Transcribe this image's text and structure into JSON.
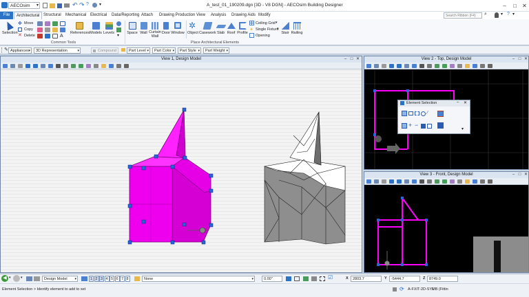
{
  "app": {
    "doc_combo": "AECOsim",
    "window_title": "A_test_01_190209.dgn [3D - V8 DGN] - AECOsim Building Designer",
    "search_placeholder": "Search Ribbon (F4)"
  },
  "tabs": [
    "File",
    "Architectural",
    "Structural",
    "Mechanical",
    "Electrical",
    "Data/Reporting",
    "Attach",
    "Drawing Production",
    "View",
    "Analysis",
    "Drawing Aids",
    "Modify"
  ],
  "ribbon": {
    "selection": "Selection",
    "move": "Move",
    "copy": "Copy",
    "delete": "Delete",
    "references": "References",
    "models": "Models",
    "levels": "Levels",
    "space": "Space",
    "wall": "Wall",
    "curtain_wall": "Curtain\nWall",
    "door": "Door",
    "window": "Window",
    "object": "Object",
    "casework": "Casework",
    "slab": "Slab",
    "roof": "Roof",
    "profile": "Profile",
    "ceiling_grid": "Ceiling Grid",
    "single_fixture": "Single Fixture",
    "opening": "Opening",
    "stair": "Stair",
    "railing": "Railing",
    "group_common": "Common Tools",
    "group_place": "Place Architectural Elements"
  },
  "attr_bar": {
    "appliances": "Appliances",
    "representation": "3D Representation",
    "compound": "Compound",
    "part_level": "Part Level",
    "part_color": "Part Color",
    "part_style": "Part Style",
    "part_weight": "Part Weight"
  },
  "views": {
    "v1": "View 1, Design Model",
    "v2": "View 2 - Top, Design Model",
    "v3": "View 3 - Front, Design Model"
  },
  "popup": {
    "title": "Element Selection"
  },
  "status": {
    "model": "Design Model",
    "view_nums": [
      "1",
      "2",
      "3",
      "4",
      "5",
      "6",
      "7",
      "8"
    ],
    "level": "None",
    "weight": "0.00\"",
    "x_label": "X",
    "x_value": "2803.7",
    "y_label": "Y",
    "y_value": "-5444.7",
    "z_label": "Z",
    "z_value": "8749.0",
    "prompt": "Element Selection > Identify element to add to set",
    "right_info": "A-FXIT-2D-SYMB (Fittin",
    "count": "1"
  },
  "colors": {
    "accent": "#2a73c7",
    "magenta": "#ff00ff",
    "selection_handle": "#2b63d9",
    "view_bg_dark": "#000000"
  }
}
